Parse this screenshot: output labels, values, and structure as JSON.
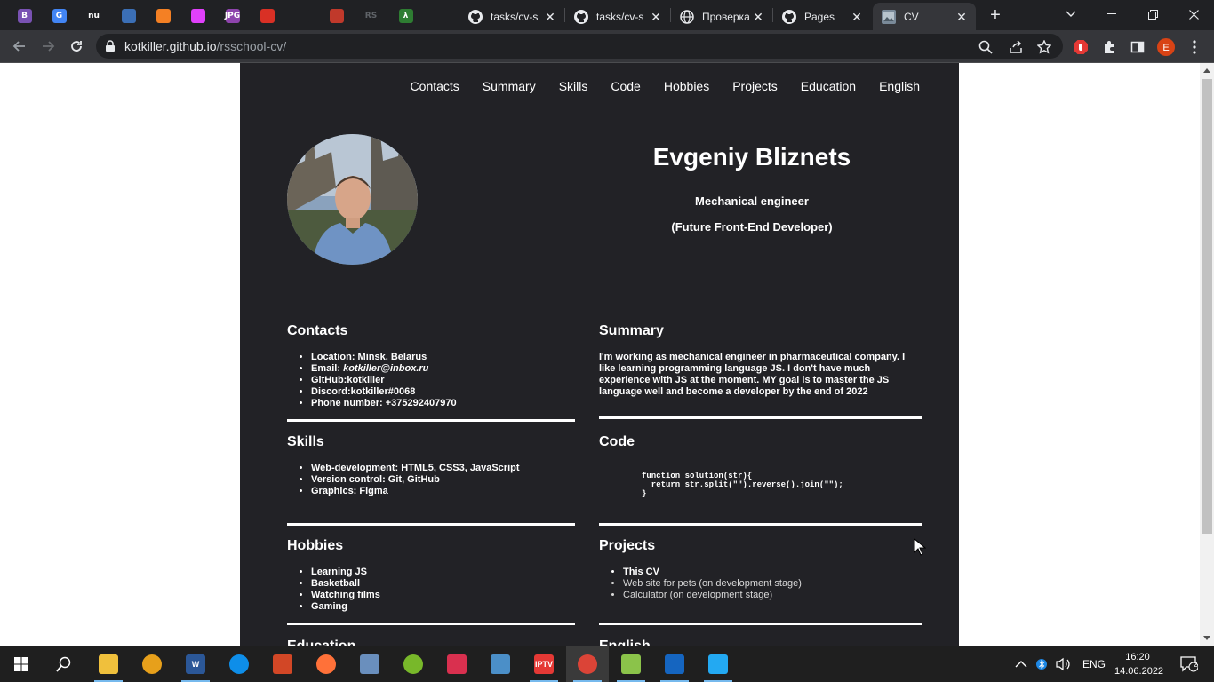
{
  "browser": {
    "tabs": [
      {
        "label": "tasks/cv-s",
        "icon": "github-icon"
      },
      {
        "label": "tasks/cv-s",
        "icon": "github-icon"
      },
      {
        "label": "Проверка",
        "icon": "globe-icon"
      },
      {
        "label": "Pages",
        "icon": "github-icon"
      },
      {
        "label": "CV",
        "icon": "cv-favicon"
      }
    ],
    "pinned": [
      {
        "icon": "bootstrap-icon",
        "text": "B",
        "color": "#7952b3"
      },
      {
        "icon": "google-translate-icon",
        "text": "G",
        "color": "#4285f4"
      },
      {
        "icon": "nu-icon",
        "text": "nu",
        "color": "#202124"
      },
      {
        "icon": "laptop-icon",
        "text": "",
        "color": "#3b6fb6"
      },
      {
        "icon": "stackoverflow-icon",
        "text": "",
        "color": "#f48024"
      },
      {
        "icon": "color-wheel-icon",
        "text": "",
        "color": "#e040fb"
      },
      {
        "icon": "jpg-icon",
        "text": "JPG",
        "color": "#8e44ad"
      },
      {
        "icon": "chrome-remote-icon",
        "text": "",
        "color": "#d93025"
      },
      {
        "icon": "github-icon",
        "text": "",
        "color": "#202124"
      },
      {
        "icon": "html-academy-icon",
        "text": "",
        "color": "#c0392b"
      },
      {
        "icon": "rs-school-icon",
        "text": "RS",
        "color": "#202124"
      },
      {
        "icon": "lambda-icon",
        "text": "λ",
        "color": "#2e7d32"
      },
      {
        "icon": "gear-icon",
        "text": "",
        "color": "#202124"
      }
    ],
    "new_tab": "+",
    "url": {
      "host": "kotkiller.github.io",
      "path": "/rsschool-cv/"
    }
  },
  "cv": {
    "nav": [
      "Contacts",
      "Summary",
      "Skills",
      "Code",
      "Hobbies",
      "Projects",
      "Education",
      "English"
    ],
    "name": "Evgeniy Bliznets",
    "role": "Mechanical engineer",
    "role_future": "(Future Front-End Developer)",
    "contacts": {
      "title": "Contacts",
      "location": "Location: Minsk, Belarus",
      "email_label": "Email: ",
      "email": "kotkiller@inbox.ru",
      "github": "GitHub:kotkiller",
      "discord": "Discord:kotkiller#0068",
      "phone": "Phone number: +375292407970"
    },
    "summary": {
      "title": "Summary",
      "text": "I'm working as mechanical engineer in pharmaceutical company. I like learning programming language JS. I don't have much experience with JS at the moment. MY goal is to master the JS language well and become a developer by the end of 2022"
    },
    "skills": {
      "title": "Skills",
      "items": [
        "Web-development: HTML5, CSS3, JavaScript",
        "Version control: Git, GitHub",
        "Graphics: Figma"
      ]
    },
    "code": {
      "title": "Code",
      "snippet": "function solution(str){\n  return str.split(\"\").reverse().join(\"\");\n}"
    },
    "hobbies": {
      "title": "Hobbies",
      "items": [
        "Learning JS",
        "Basketball",
        "Watching films",
        "Gaming"
      ]
    },
    "projects": {
      "title": "Projects",
      "items": [
        "This CV",
        "Web site for pets (on development stage)",
        "Calculator (on development stage)"
      ]
    },
    "education": {
      "title": "Education"
    },
    "english": {
      "title": "English"
    }
  },
  "taskbar": {
    "apps": [
      {
        "icon": "file-explorer-icon",
        "color": "#f0c03c"
      },
      {
        "icon": "archicad-icon",
        "color": "#e7a01b"
      },
      {
        "icon": "word-icon",
        "color": "#2b5797",
        "text": "W"
      },
      {
        "icon": "teamviewer-icon",
        "color": "#0e8ee9"
      },
      {
        "icon": "git-kraken-icon",
        "color": "#d24726"
      },
      {
        "icon": "firefox-icon",
        "color": "#ff7139"
      },
      {
        "icon": "network-monitor-icon",
        "color": "#6a8fbd"
      },
      {
        "icon": "utorrent-icon",
        "color": "#78b82a"
      },
      {
        "icon": "puzzle-game-icon",
        "color": "#d9304f"
      },
      {
        "icon": "image-viewer-icon",
        "color": "#4b8fc8"
      },
      {
        "icon": "iptv-checker-icon",
        "color": "#e53935",
        "text": "IPTV"
      },
      {
        "icon": "chrome-icon",
        "color": "#db4437"
      },
      {
        "icon": "notepad-icon",
        "color": "#8bc34a"
      },
      {
        "icon": "save-disk-icon",
        "color": "#1565c0"
      },
      {
        "icon": "vscode-icon",
        "color": "#23a9f2"
      }
    ],
    "language": "ENG",
    "time": "16:20",
    "date": "14.06.2022",
    "notifications": "2"
  }
}
